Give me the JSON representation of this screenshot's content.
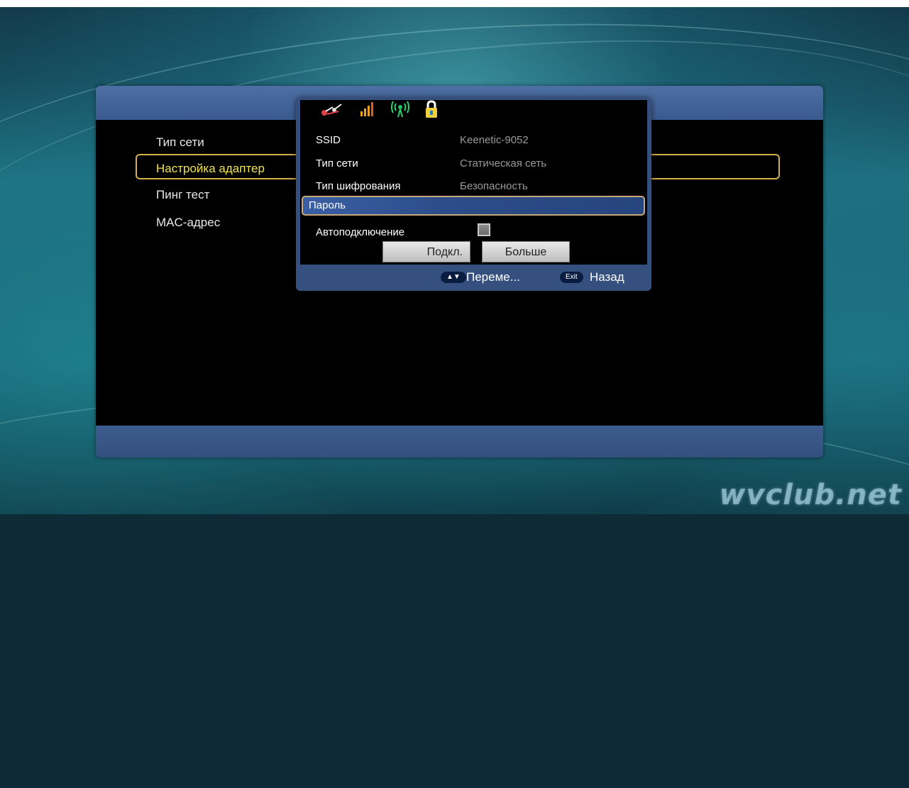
{
  "main_menu": {
    "header_title": "",
    "items": [
      {
        "label": "Тип сети"
      },
      {
        "label": "Настройка адаптер"
      },
      {
        "label": "Пинг тест"
      },
      {
        "label": "MAC-адрес"
      }
    ]
  },
  "status_icons": [
    {
      "name": "satellite-icon",
      "glyph": "⚡"
    },
    {
      "name": "signal-strength-icon",
      "glyph": "▂▃▅"
    },
    {
      "name": "wifi-antenna-icon",
      "glyph": "📶"
    },
    {
      "name": "lock-icon",
      "glyph": "🔒"
    }
  ],
  "wifi_dialog": {
    "rows": [
      {
        "label": "SSID",
        "value": "Keenetic-9052"
      },
      {
        "label": "Тип сети",
        "value": "Статическая сеть"
      },
      {
        "label": "Тип шифрования",
        "value": "Безопасность"
      },
      {
        "label": "Пароль",
        "value": ""
      },
      {
        "label": "Автоподключение",
        "value": ""
      }
    ],
    "autoconnect_checked": false,
    "buttons": {
      "connect": "Подкл.",
      "more": "Больше"
    },
    "hints": {
      "move_key": "▲▼",
      "move_label": "Переме...",
      "exit_key": "Exit",
      "exit_label": "Назад"
    }
  },
  "watermark": "wvclub.net",
  "colors": {
    "selected_text": "#f2e34a",
    "highlight_border": "#d4b04a",
    "panel_blue": "#35507e"
  }
}
